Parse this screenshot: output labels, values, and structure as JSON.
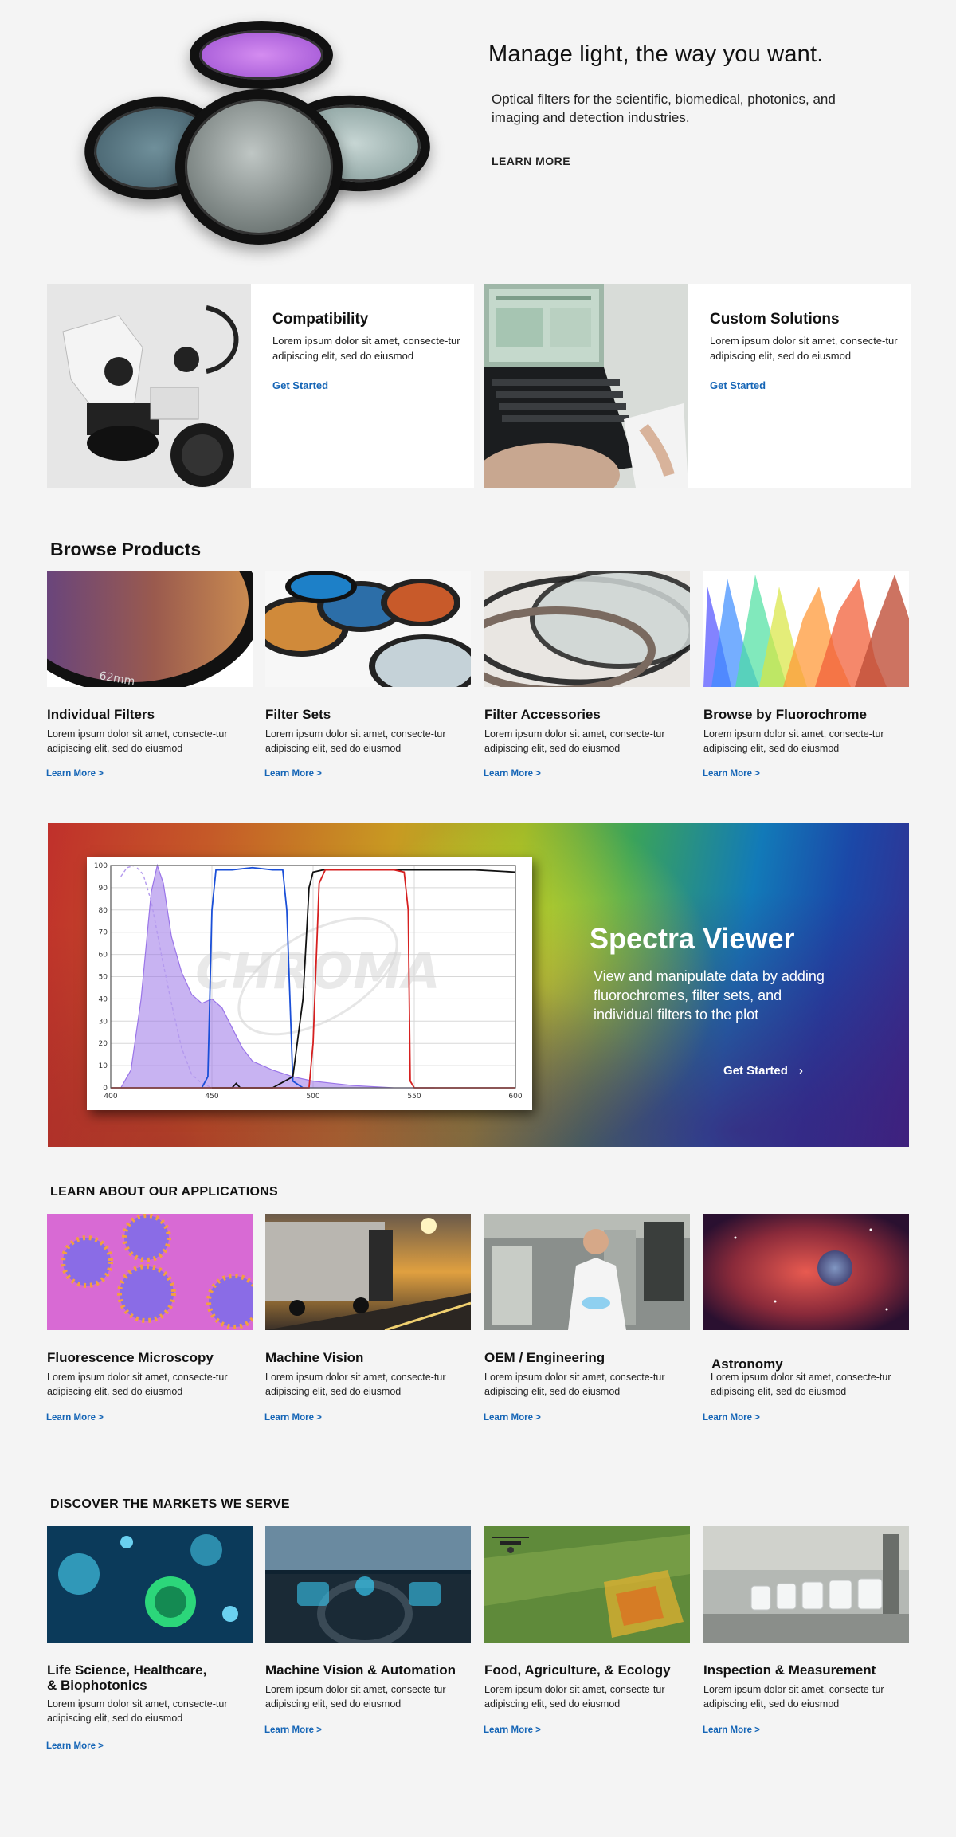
{
  "hero": {
    "title": "Manage light, the way you want.",
    "subtitle": "Optical filters for the scientific, biomedical, photonics, and imaging and detection industries.",
    "link": "LEARN MORE"
  },
  "features": [
    {
      "title": "Compatibility",
      "desc": "Lorem ipsum dolor sit amet, consecte-tur adipiscing elit, sed do eiusmod",
      "link": "Get Started"
    },
    {
      "title": "Custom Solutions",
      "desc": "Lorem ipsum dolor sit amet, consecte-tur adipiscing elit, sed do eiusmod",
      "link": "Get Started"
    }
  ],
  "browse": {
    "heading": "Browse Products",
    "items": [
      {
        "title": "Individual Filters",
        "desc": "Lorem ipsum dolor sit amet, consecte-tur adipiscing elit, sed do eiusmod",
        "link": "Learn More >",
        "label": "62mm"
      },
      {
        "title": "Filter Sets",
        "desc": "Lorem ipsum dolor sit amet, consecte-tur adipiscing elit, sed do eiusmod",
        "link": "Learn More >"
      },
      {
        "title": "Filter Accessories",
        "desc": "Lorem ipsum dolor sit amet, consecte-tur adipiscing elit, sed do eiusmod",
        "link": "Learn More >"
      },
      {
        "title": "Browse by Fluorochrome",
        "desc": "Lorem ipsum dolor sit amet, consecte-tur adipiscing elit, sed do eiusmod",
        "link": "Learn More >"
      }
    ]
  },
  "spectra": {
    "title": "Spectra Viewer",
    "desc": "View and manipulate data by adding fluorochromes, filter sets, and individual filters to the plot",
    "button": "Get Started",
    "watermark": "CHROMA"
  },
  "chart_data": {
    "type": "line",
    "xlim": [
      400,
      600
    ],
    "ylim": [
      0,
      100
    ],
    "xticks": [
      400,
      450,
      500,
      550,
      600
    ],
    "yticks": [
      0,
      10,
      20,
      30,
      40,
      50,
      60,
      70,
      80,
      90,
      100
    ],
    "grid": true,
    "series": [
      {
        "color": "#9a75e8",
        "style": "filled-excitation",
        "x": [
          405,
          410,
          415,
          420,
          423,
          426,
          430,
          435,
          440,
          445,
          450,
          455,
          460,
          465,
          470,
          480,
          490,
          500,
          510,
          520,
          540,
          560
        ],
        "y": [
          0,
          8,
          40,
          88,
          100,
          92,
          68,
          52,
          42,
          38,
          40,
          36,
          27,
          18,
          12,
          8,
          5,
          3,
          2,
          1,
          0,
          0
        ]
      },
      {
        "color": "#b49aee",
        "style": "dashed-emission",
        "x": [
          405,
          408,
          412,
          416,
          420,
          425,
          430,
          435,
          440,
          445,
          450
        ],
        "y": [
          95,
          99,
          100,
          96,
          84,
          60,
          38,
          18,
          6,
          2,
          0
        ]
      },
      {
        "color": "#1a4fd8",
        "style": "excitation-filter",
        "x": [
          445,
          448,
          450,
          452,
          460,
          470,
          480,
          485,
          487,
          490,
          495
        ],
        "y": [
          0,
          5,
          80,
          98,
          98,
          99,
          98,
          98,
          80,
          3,
          0
        ]
      },
      {
        "color": "#111111",
        "style": "dichroic",
        "x": [
          450,
          460,
          462,
          464,
          470,
          480,
          490,
          495,
          498,
          500,
          505,
          520,
          550,
          580,
          600
        ],
        "y": [
          0,
          0,
          2,
          0,
          0,
          0,
          5,
          40,
          90,
          97,
          98,
          98,
          98,
          98,
          97
        ]
      },
      {
        "color": "#d62020",
        "style": "emission-filter",
        "x": [
          400,
          498,
          500,
          503,
          506,
          520,
          540,
          545,
          547,
          548,
          550,
          600
        ],
        "y": [
          0,
          0,
          20,
          92,
          98,
          98,
          98,
          97,
          80,
          3,
          0,
          0
        ]
      }
    ]
  },
  "applications": {
    "heading": "LEARN ABOUT OUR APPLICATIONS",
    "items": [
      {
        "title": "Fluorescence Microscopy",
        "desc": "Lorem ipsum dolor sit amet, consecte-tur adipiscing elit, sed do eiusmod",
        "link": "Learn More >"
      },
      {
        "title": "Machine Vision",
        "desc": "Lorem ipsum dolor sit amet, consecte-tur adipiscing elit, sed do eiusmod",
        "link": "Learn More >"
      },
      {
        "title": "OEM / Engineering",
        "desc": "Lorem ipsum dolor sit amet, consecte-tur adipiscing elit, sed do eiusmod",
        "link": "Learn More >"
      },
      {
        "title": "Astronomy",
        "desc": "Lorem ipsum dolor sit amet, consecte-tur adipiscing elit, sed do eiusmod",
        "link": "Learn More >"
      }
    ]
  },
  "markets": {
    "heading": "DISCOVER THE MARKETS WE SERVE",
    "items": [
      {
        "title": "Life Science, Healthcare, & Biophotonics",
        "desc": "Lorem ipsum dolor sit amet, consecte-tur adipiscing elit, sed do eiusmod",
        "link": "Learn More >"
      },
      {
        "title": "Machine Vision & Automation",
        "desc": "Lorem ipsum dolor sit amet, consecte-tur adipiscing elit, sed do eiusmod",
        "link": "Learn More >"
      },
      {
        "title": "Food, Agriculture, & Ecology",
        "desc": "Lorem ipsum dolor sit amet, consecte-tur adipiscing elit, sed do eiusmod",
        "link": "Learn More >"
      },
      {
        "title": "Inspection & Measurement",
        "desc": "Lorem ipsum dolor sit amet, consecte-tur adipiscing elit, sed do eiusmod",
        "link": "Learn More >"
      }
    ]
  },
  "colors": {
    "accent": "#1565b6",
    "background": "#f4f4f4",
    "text": "#111111"
  }
}
